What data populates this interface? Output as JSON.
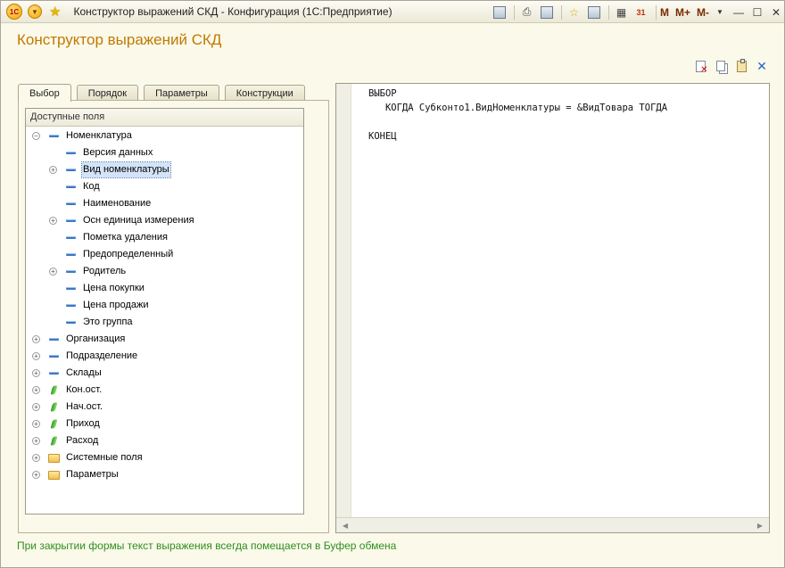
{
  "window": {
    "title": "Конструктор выражений СКД - Конфигурация  (1С:Предприятие)",
    "logo": "1С",
    "toolbar_m": [
      "M",
      "M+",
      "M-"
    ],
    "calendar_day": "31"
  },
  "form": {
    "title": "Конструктор выражений СКД"
  },
  "tabs": [
    {
      "label": "Выбор",
      "active": true
    },
    {
      "label": "Порядок",
      "active": false
    },
    {
      "label": "Параметры",
      "active": false
    },
    {
      "label": "Конструкции",
      "active": false
    }
  ],
  "tree": {
    "header": "Доступные поля",
    "items": [
      {
        "label": "Номенклатура",
        "level": 0,
        "icon": "dash-icon",
        "expander": "minus"
      },
      {
        "label": "Версия данных",
        "level": 1,
        "icon": "dash-icon",
        "expander": ""
      },
      {
        "label": "Вид номенклатуры",
        "level": 1,
        "icon": "dash-icon",
        "expander": "plus",
        "selected": true
      },
      {
        "label": "Код",
        "level": 1,
        "icon": "dash-icon",
        "expander": ""
      },
      {
        "label": "Наименование",
        "level": 1,
        "icon": "dash-icon",
        "expander": ""
      },
      {
        "label": "Осн единица измерения",
        "level": 1,
        "icon": "dash-icon",
        "expander": "plus"
      },
      {
        "label": "Пометка удаления",
        "level": 1,
        "icon": "dash-icon",
        "expander": ""
      },
      {
        "label": "Предопределенный",
        "level": 1,
        "icon": "dash-icon",
        "expander": ""
      },
      {
        "label": "Родитель",
        "level": 1,
        "icon": "dash-icon",
        "expander": "plus"
      },
      {
        "label": "Цена покупки",
        "level": 1,
        "icon": "dash-icon",
        "expander": ""
      },
      {
        "label": "Цена продажи",
        "level": 1,
        "icon": "dash-icon",
        "expander": ""
      },
      {
        "label": "Это группа",
        "level": 1,
        "icon": "dash-icon",
        "expander": ""
      },
      {
        "label": "Организация",
        "level": 0,
        "icon": "dash-icon",
        "expander": "plus"
      },
      {
        "label": "Подразделение",
        "level": 0,
        "icon": "dash-icon",
        "expander": "plus"
      },
      {
        "label": "Склады",
        "level": 0,
        "icon": "dash-icon",
        "expander": "plus"
      },
      {
        "label": "Кон.ост.",
        "level": 0,
        "icon": "leaf-icon",
        "expander": "plus"
      },
      {
        "label": "Нач.ост.",
        "level": 0,
        "icon": "leaf-icon",
        "expander": "plus"
      },
      {
        "label": "Приход",
        "level": 0,
        "icon": "leaf-icon",
        "expander": "plus"
      },
      {
        "label": "Расход",
        "level": 0,
        "icon": "leaf-icon",
        "expander": "plus"
      },
      {
        "label": "Системные поля",
        "level": 0,
        "icon": "folder-icon",
        "expander": "plus"
      },
      {
        "label": "Параметры",
        "level": 0,
        "icon": "folder-icon",
        "expander": "plus"
      }
    ]
  },
  "editor": {
    "lines": [
      "ВЫБОР",
      "   КОГДА Субконто1.ВидНоменклатуры = &ВидТовара ТОГДА",
      "",
      "КОНЕЦ"
    ]
  },
  "footer": {
    "text": "При закрытии формы текст выражения всегда помещается в Буфер обмена"
  },
  "colors": {
    "title_orange": "#c07a00",
    "footer_green": "#2e8f1e",
    "selection": "#d3e4f8",
    "background": "#fbf9ea"
  }
}
